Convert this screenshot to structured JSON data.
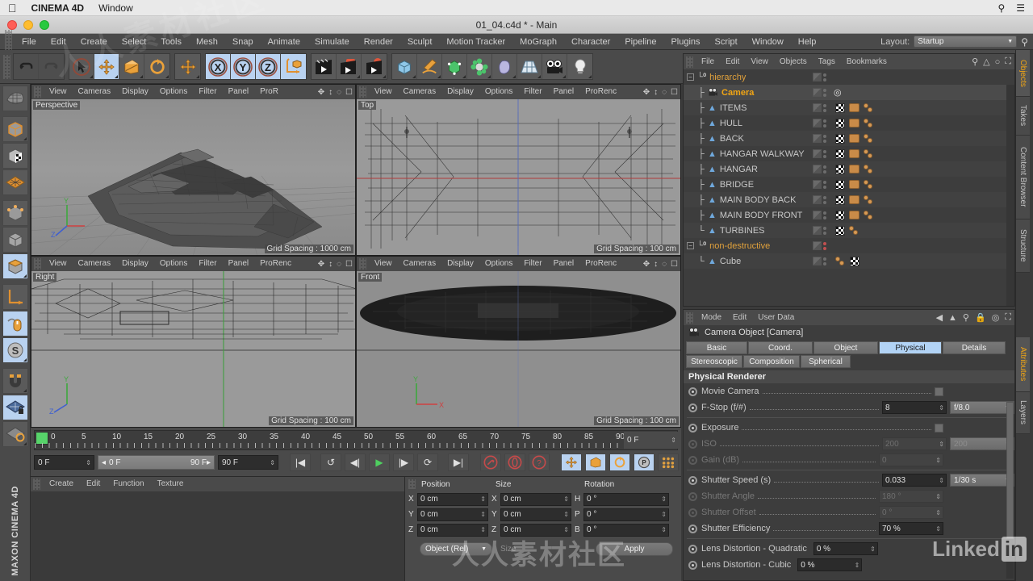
{
  "mac_menu": {
    "apple": "apple-icon",
    "app_name": "CINEMA 4D",
    "window": "Window",
    "search_icon": "search-icon",
    "list_icon": "list-icon"
  },
  "title_bar": {
    "title": "01_04.c4d * - Main"
  },
  "menu": {
    "items": [
      "File",
      "Edit",
      "Create",
      "Select",
      "Tools",
      "Mesh",
      "Snap",
      "Animate",
      "Simulate",
      "Render",
      "Sculpt",
      "Motion Tracker",
      "MoGraph",
      "Character",
      "Pipeline",
      "Plugins",
      "Script",
      "Window",
      "Help"
    ],
    "layout_label": "Layout:",
    "layout_value": "Startup"
  },
  "toolbar": {
    "groups": [
      {
        "buttons": [
          {
            "name": "undo",
            "glyph": "↶",
            "state": "normal"
          },
          {
            "name": "redo",
            "glyph": "↷",
            "state": "disabled"
          }
        ]
      },
      {
        "buttons": [
          {
            "name": "live-select",
            "glyph": "cursor",
            "state": "normal"
          },
          {
            "name": "move-tool",
            "glyph": "move",
            "state": "selected"
          },
          {
            "name": "scale-tool",
            "glyph": "scale",
            "state": "normal"
          },
          {
            "name": "rotate-tool",
            "glyph": "rotate",
            "state": "normal"
          }
        ]
      },
      {
        "buttons": [
          {
            "name": "move-axis",
            "glyph": "move",
            "state": "normal"
          }
        ]
      },
      {
        "buttons": [
          {
            "name": "lock-x",
            "glyph": "X",
            "state": "selected"
          },
          {
            "name": "lock-y",
            "glyph": "Y",
            "state": "selected"
          },
          {
            "name": "lock-z",
            "glyph": "Z",
            "state": "selected"
          },
          {
            "name": "world-object-axis",
            "glyph": "axis",
            "state": "selected"
          }
        ]
      },
      {
        "buttons": [
          {
            "name": "render-view",
            "glyph": "clapper",
            "state": "normal"
          },
          {
            "name": "render-to-picture-viewer",
            "glyph": "clapper-red",
            "state": "normal"
          },
          {
            "name": "render-settings",
            "glyph": "clapper-gear",
            "state": "normal"
          }
        ]
      },
      {
        "buttons": [
          {
            "name": "add-cube",
            "glyph": "cube",
            "state": "normal"
          },
          {
            "name": "add-spline",
            "glyph": "pen",
            "state": "normal"
          },
          {
            "name": "add-nurbs",
            "glyph": "nurbs",
            "state": "normal"
          },
          {
            "name": "add-array",
            "glyph": "array",
            "state": "normal"
          },
          {
            "name": "add-deformer",
            "glyph": "bend",
            "state": "normal"
          },
          {
            "name": "add-environment",
            "glyph": "floor",
            "state": "normal"
          },
          {
            "name": "add-camera",
            "glyph": "camera",
            "state": "normal"
          },
          {
            "name": "add-light",
            "glyph": "bulb",
            "state": "normal"
          }
        ]
      }
    ]
  },
  "left_palette": {
    "items": [
      {
        "name": "make-editable",
        "glyph": "sphere-wire",
        "state": "normal"
      },
      {
        "name": "model-mode",
        "glyph": "cube-orange",
        "state": "normal"
      },
      {
        "name": "texture-mode",
        "glyph": "cube-checker",
        "state": "normal"
      },
      {
        "name": "points-mode",
        "glyph": "grid-orange",
        "state": "normal"
      },
      {
        "name": "edges-mode",
        "glyph": "cube-points",
        "state": "normal"
      },
      {
        "name": "polygons-mode",
        "glyph": "cube-plain",
        "state": "normal"
      },
      {
        "name": "object-axis-mode",
        "glyph": "cube-top-orange",
        "state": "selected"
      },
      {
        "name": "world-coordinate",
        "glyph": "axis-L",
        "state": "normal"
      },
      {
        "name": "enable-snap",
        "glyph": "mouse-orange",
        "state": "selected"
      },
      {
        "name": "soft-selection",
        "glyph": "s-circle",
        "state": "selected"
      },
      {
        "name": "magnet",
        "glyph": "magnet",
        "state": "normal"
      },
      {
        "name": "lock-workplane",
        "glyph": "plane-lock",
        "state": "selected"
      },
      {
        "name": "workplane-rotate",
        "glyph": "plane-rotate",
        "state": "normal"
      }
    ],
    "brand_line1": "MAXON",
    "brand_line2": "CINEMA 4D"
  },
  "viewport_menu": [
    "View",
    "Cameras",
    "Display",
    "Options",
    "Filter",
    "Panel"
  ],
  "viewports": [
    {
      "name": "perspective",
      "label": "Perspective",
      "pror": "ProR",
      "grid": "Grid Spacing : 1000 cm"
    },
    {
      "name": "top",
      "label": "Top",
      "pror": "ProRenc",
      "grid": "Grid Spacing : 100 cm"
    },
    {
      "name": "right",
      "label": "Right",
      "pror": "ProRenc",
      "grid": "Grid Spacing : 100 cm"
    },
    {
      "name": "front",
      "label": "Front",
      "pror": "ProRenc",
      "grid": "Grid Spacing : 100 cm"
    }
  ],
  "timeline": {
    "ticks": [
      "0",
      "5",
      "10",
      "15",
      "20",
      "25",
      "30",
      "35",
      "40",
      "45",
      "50",
      "55",
      "60",
      "65",
      "70",
      "75",
      "80",
      "85",
      "90"
    ],
    "current_frame": "0 F",
    "range_start": "0 F",
    "range_end": "90 F",
    "end_field": "90 F",
    "preview_field": "0 F",
    "transport": [
      {
        "name": "go-to-start",
        "glyph": "|◀"
      },
      {
        "name": "loop-preview",
        "glyph": "↺"
      },
      {
        "name": "step-back",
        "glyph": "◀|"
      },
      {
        "name": "play",
        "glyph": "▶"
      },
      {
        "name": "step-forward",
        "glyph": "|▶"
      },
      {
        "name": "record-loop",
        "glyph": "⟳"
      },
      {
        "name": "go-to-end",
        "glyph": "▶|"
      }
    ],
    "record_buttons": [
      {
        "name": "record-active-objects",
        "glyph": "key"
      },
      {
        "name": "autokeying",
        "glyph": "circle"
      },
      {
        "name": "keyframe-selection",
        "glyph": "?"
      }
    ],
    "key_toggles": [
      {
        "name": "key-position",
        "glyph": "move"
      },
      {
        "name": "key-scale",
        "glyph": "scale"
      },
      {
        "name": "key-rotation",
        "glyph": "rotate"
      },
      {
        "name": "key-param",
        "glyph": "P"
      },
      {
        "name": "key-pla",
        "glyph": "dots"
      }
    ],
    "layout_btn": {
      "name": "animation-layout",
      "glyph": "film"
    }
  },
  "material_panel": {
    "menu": [
      "Create",
      "Edit",
      "Function",
      "Texture"
    ]
  },
  "coordinates": {
    "headers": [
      "Position",
      "Size",
      "Rotation"
    ],
    "rows": [
      {
        "pos_axis": "X",
        "pos": "0 cm",
        "size_axis": "X",
        "size": "0 cm",
        "rot_axis": "H",
        "rot": "0 °"
      },
      {
        "pos_axis": "Y",
        "pos": "0 cm",
        "size_axis": "Y",
        "size": "0 cm",
        "rot_axis": "P",
        "rot": "0 °"
      },
      {
        "pos_axis": "Z",
        "pos": "0 cm",
        "size_axis": "Z",
        "size": "0 cm",
        "rot_axis": "B",
        "rot": "0 °"
      }
    ],
    "mode_select": "Object (Rel)",
    "size_mode": "Size",
    "apply_label": "Apply"
  },
  "object_manager": {
    "menu": [
      "File",
      "Edit",
      "View",
      "Objects",
      "Tags",
      "Bookmarks"
    ],
    "icons": [
      "search-icon",
      "home-icon",
      "eye-icon",
      "expand-icon"
    ],
    "rows": [
      {
        "name": "hierarchy",
        "type": "null",
        "depth": 0,
        "selected": false,
        "orange": true,
        "expander": "−",
        "tags": []
      },
      {
        "name": "Camera",
        "type": "camera",
        "depth": 1,
        "selected": true,
        "orange": false,
        "expander": "",
        "tags": [
          "target"
        ]
      },
      {
        "name": "ITEMS",
        "type": "poly",
        "depth": 1,
        "selected": false,
        "orange": false,
        "expander": "",
        "tags": [
          "checker",
          "texture",
          "selection"
        ]
      },
      {
        "name": "HULL",
        "type": "poly",
        "depth": 1,
        "selected": false,
        "orange": false,
        "expander": "",
        "tags": [
          "checker",
          "texture",
          "selection"
        ]
      },
      {
        "name": "BACK",
        "type": "poly",
        "depth": 1,
        "selected": false,
        "orange": false,
        "expander": "",
        "tags": [
          "checker",
          "texture",
          "selection"
        ]
      },
      {
        "name": "HANGAR WALKWAY",
        "type": "poly",
        "depth": 1,
        "selected": false,
        "orange": false,
        "expander": "",
        "tags": [
          "checker",
          "texture",
          "selection"
        ]
      },
      {
        "name": "HANGAR",
        "type": "poly",
        "depth": 1,
        "selected": false,
        "orange": false,
        "expander": "",
        "tags": [
          "checker",
          "texture",
          "selection"
        ]
      },
      {
        "name": "BRIDGE",
        "type": "poly",
        "depth": 1,
        "selected": false,
        "orange": false,
        "expander": "",
        "tags": [
          "checker",
          "texture",
          "selection"
        ]
      },
      {
        "name": "MAIN BODY BACK",
        "type": "poly",
        "depth": 1,
        "selected": false,
        "orange": false,
        "expander": "",
        "tags": [
          "checker",
          "texture",
          "selection"
        ]
      },
      {
        "name": "MAIN BODY FRONT",
        "type": "poly",
        "depth": 1,
        "selected": false,
        "orange": false,
        "expander": "",
        "tags": [
          "checker",
          "texture",
          "selection"
        ]
      },
      {
        "name": "TURBINES",
        "type": "poly",
        "depth": 1,
        "selected": false,
        "orange": false,
        "expander": "",
        "tags": [
          "checker",
          "selection"
        ]
      },
      {
        "name": "non-destructive",
        "type": "null",
        "depth": 0,
        "selected": false,
        "orange": true,
        "expander": "−",
        "tags": []
      },
      {
        "name": "Cube",
        "type": "poly",
        "depth": 1,
        "selected": false,
        "orange": false,
        "expander": "",
        "tags": [
          "selection",
          "checker"
        ]
      }
    ]
  },
  "attributes": {
    "menu": [
      "Mode",
      "Edit",
      "User Data"
    ],
    "icons": [
      "back-arrow-icon",
      "up-arrow-icon",
      "search-icon",
      "lock-icon",
      "target-icon",
      "expand-icon"
    ],
    "object_title": "Camera Object [Camera]",
    "tabs_row1": [
      "Basic",
      "Coord.",
      "Object",
      "Physical",
      "Details"
    ],
    "tabs_row2": [
      "Stereoscopic",
      "Composition",
      "Spherical"
    ],
    "active_tab": "Physical",
    "section_title": "Physical Renderer",
    "properties": [
      {
        "label": "Movie Camera",
        "type": "checkbox",
        "value": "",
        "enabled": true,
        "select": null
      },
      {
        "label": "F-Stop (f/#)",
        "type": "number",
        "value": "8",
        "enabled": true,
        "select": "f/8.0"
      },
      {
        "label": "Exposure",
        "type": "checkbox",
        "value": "",
        "enabled": true,
        "select": null
      },
      {
        "label": "ISO",
        "type": "number",
        "value": "200",
        "enabled": false,
        "select": "200"
      },
      {
        "label": "Gain (dB)",
        "type": "number",
        "value": "0",
        "enabled": false,
        "select": null
      },
      {
        "label": "Shutter Speed (s)",
        "type": "number",
        "value": "0.033",
        "enabled": true,
        "select": "1/30 s"
      },
      {
        "label": "Shutter Angle",
        "type": "number",
        "value": "180 °",
        "enabled": false,
        "select": null
      },
      {
        "label": "Shutter Offset",
        "type": "number",
        "value": "0 °",
        "enabled": false,
        "select": null
      },
      {
        "label": "Shutter Efficiency",
        "type": "number",
        "value": "70 %",
        "enabled": true,
        "select": null
      },
      {
        "label": "Lens Distortion - Quadratic",
        "type": "number",
        "value": "0 %",
        "enabled": true,
        "select": null
      },
      {
        "label": "Lens Distortion - Cubic",
        "type": "number",
        "value": "0 %",
        "enabled": true,
        "select": null
      }
    ]
  },
  "right_tabs": [
    {
      "label": "Objects",
      "active": true
    },
    {
      "label": "Takes",
      "active": false
    },
    {
      "label": "Content Browser",
      "active": false
    },
    {
      "label": "Structure",
      "active": false
    },
    {
      "label": "Attributes",
      "active": true
    },
    {
      "label": "Layers",
      "active": false
    }
  ],
  "watermarks": {
    "linkedin": "Linked",
    "linkedin_in": "in",
    "cn": "人人素材社区"
  }
}
